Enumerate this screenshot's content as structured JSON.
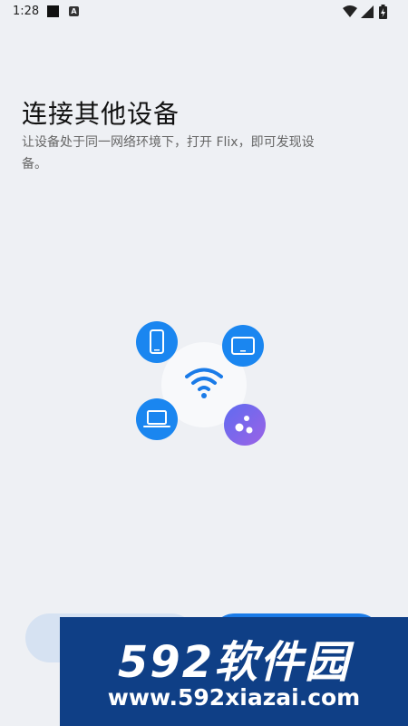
{
  "status_bar": {
    "time": "1:28",
    "notification_letter": "A"
  },
  "header": {
    "title": "连接其他设备",
    "subtitle": "让设备处于同一网络环境下，打开 Flix，即可发现设备。"
  },
  "illustration": {
    "devices": [
      "phone-icon",
      "tablet-icon",
      "laptop-icon",
      "more-devices-icon"
    ],
    "center": "wifi-icon",
    "colors": {
      "device_blue": "#1a86f0",
      "wifi_blue": "#1a7be8",
      "more_gradient": [
        "#5f6bf0",
        "#9b63e6"
      ]
    }
  },
  "buttons": {
    "left_label": "",
    "right_label": ""
  },
  "watermark": {
    "brand": "592软件园",
    "url": "www.592xiazai.com"
  }
}
